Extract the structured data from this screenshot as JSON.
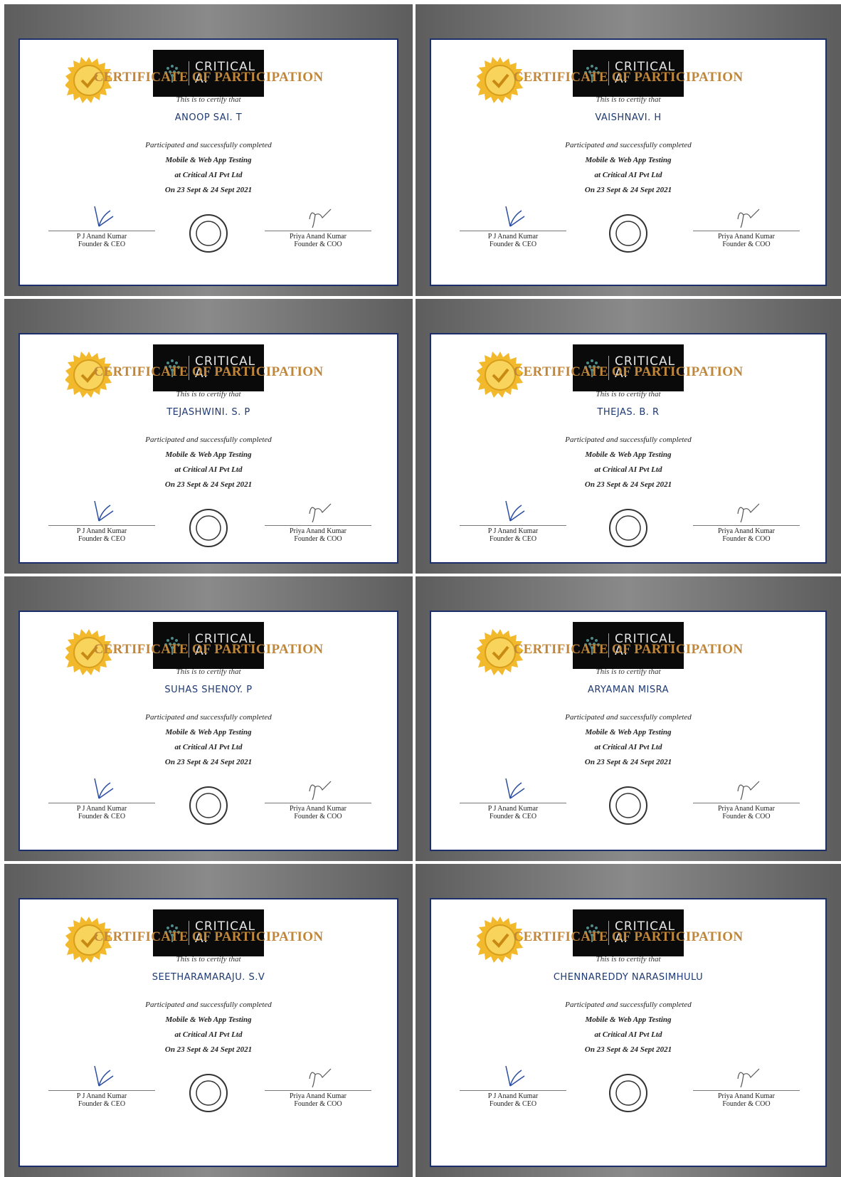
{
  "shared": {
    "logo_line1": "CRITICAL",
    "logo_line2": "AI",
    "title": "CERTIFICATE OF PARTICIPATION",
    "certify_text": "This is to certify that",
    "participated_text": "Participated and successfully completed",
    "course": "Mobile & Web App Testing",
    "company": "at Critical AI Pvt Ltd",
    "dates": "On 23 Sept & 24 Sept 2021",
    "signatory_left_name": "P J Anand Kumar",
    "signatory_left_role": "Founder & CEO",
    "signatory_right_name": "Priya Anand Kumar",
    "signatory_right_role": "Founder & COO"
  },
  "certificates": [
    {
      "recipient": "ANOOP SAI. T"
    },
    {
      "recipient": "VAISHNAVI. H"
    },
    {
      "recipient": "TEJASHWINI. S. P"
    },
    {
      "recipient": "THEJAS. B. R"
    },
    {
      "recipient": "SUHAS SHENOY. P"
    },
    {
      "recipient": "ARYAMAN MISRA"
    },
    {
      "recipient": "SEETHARAMARAJU. S.V"
    },
    {
      "recipient": "CHENNAREDDY NARASIMHULU"
    }
  ],
  "colors": {
    "title": "#c0873a",
    "recipient": "#1e3a73",
    "border": "#1c2f6b",
    "seal_gold": "#f2c23a"
  }
}
